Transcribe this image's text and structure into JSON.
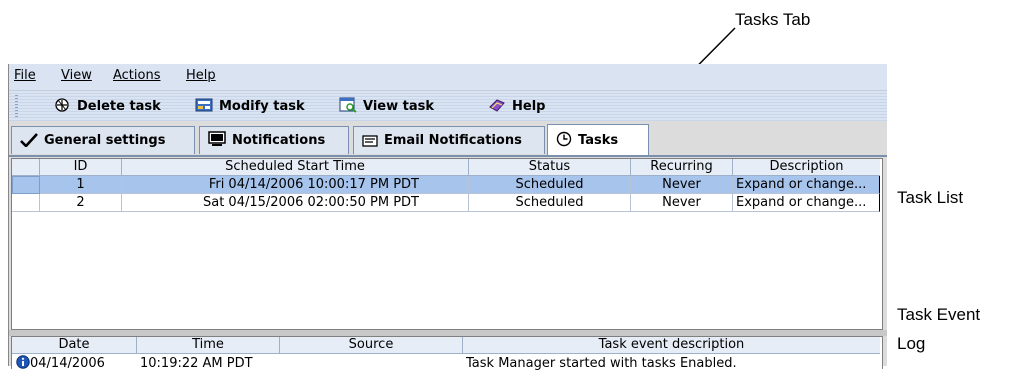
{
  "annotations": {
    "tasks_tab": "Tasks Tab",
    "task_list": "Task List",
    "task_event_log_line1": "Task Event",
    "task_event_log_line2": "Log"
  },
  "menu": {
    "file": "File",
    "view": "View",
    "actions": "Actions",
    "help": "Help"
  },
  "toolbar": {
    "delete_task": "Delete task",
    "modify_task": "Modify task",
    "view_task": "View task",
    "help": "Help"
  },
  "tabs": [
    {
      "label": "General settings",
      "icon": "checkmark-icon"
    },
    {
      "label": "Notifications",
      "icon": "monitor-icon"
    },
    {
      "label": "Email Notifications",
      "icon": "envelope-icon"
    },
    {
      "label": "Tasks",
      "icon": "clock-icon",
      "active": true
    }
  ],
  "task_table": {
    "columns": [
      "ID",
      "Scheduled Start Time",
      "Status",
      "Recurring",
      "Description"
    ],
    "rows": [
      {
        "id": "1",
        "start": "Fri 04/14/2006 10:00:17 PM PDT",
        "status": "Scheduled",
        "recurring": "Never",
        "description": "Expand or change..."
      },
      {
        "id": "2",
        "start": "Sat 04/15/2006 02:00:50 PM PDT",
        "status": "Scheduled",
        "recurring": "Never",
        "description": "Expand or change..."
      }
    ]
  },
  "event_table": {
    "columns": [
      "Date",
      "Time",
      "Source",
      "Task event description"
    ],
    "rows": [
      {
        "date": "04/14/2006",
        "time": "10:19:22 AM PDT",
        "source": "",
        "description": "Task Manager started with tasks Enabled."
      }
    ]
  },
  "colors": {
    "selected_row": "#a7c4ec",
    "menubar": "#d9e3f2",
    "tab_border": "#7b8fae"
  }
}
